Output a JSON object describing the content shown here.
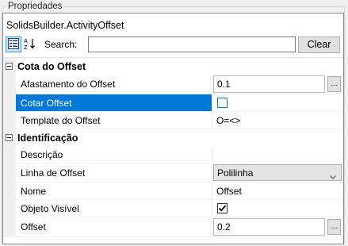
{
  "group": {
    "title": "Propriedades"
  },
  "object_name": "SolidsBuilder.ActivityOffset",
  "toolbar": {
    "categorized_icon": "categorized-icon",
    "sort_icon": "sort-az-icon",
    "search_label": "Search:",
    "search_value": "",
    "clear_label": "Clear"
  },
  "categories": [
    {
      "name": "Cota do Offset",
      "properties": [
        {
          "name": "Afastamento do Offset",
          "value": "0.1",
          "editor": "text-ellipsis"
        },
        {
          "name": "Cotar Offset",
          "value": "",
          "editor": "checkbox",
          "checked": false,
          "selected": true
        },
        {
          "name": "Template do Offset",
          "value": "O=<>",
          "editor": "text"
        }
      ]
    },
    {
      "name": "Identificação",
      "properties": [
        {
          "name": "Descrição",
          "value": "",
          "editor": "text"
        },
        {
          "name": "Linha de Offset",
          "value": "Polilinha",
          "editor": "dropdown"
        },
        {
          "name": "Nome",
          "value": "Offset",
          "editor": "text"
        },
        {
          "name": "Objeto Visível",
          "value": "",
          "editor": "checkbox",
          "checked": true
        },
        {
          "name": "Offset",
          "value": "0.2",
          "editor": "text-ellipsis"
        }
      ]
    }
  ],
  "colors": {
    "selection": "#0078d7",
    "gutter": "#f0f0f0",
    "accent_border": "#3399ff"
  }
}
